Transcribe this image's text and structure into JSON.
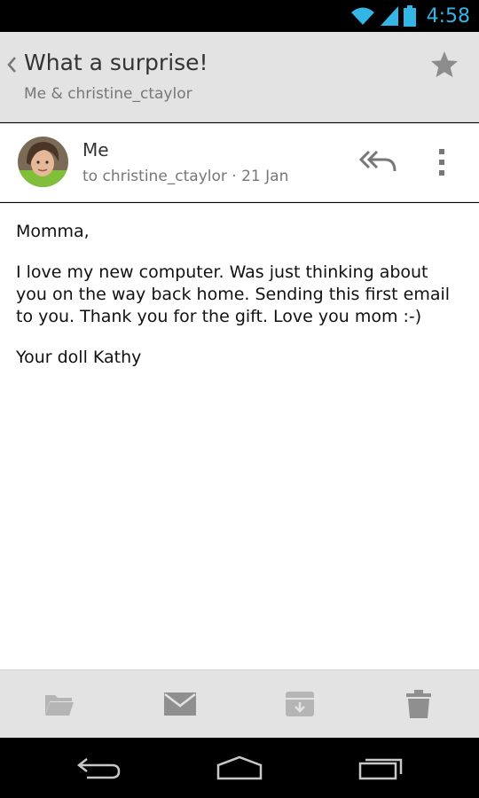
{
  "status_bar": {
    "time": "4:58",
    "icons": [
      "wifi-icon",
      "signal-icon",
      "battery-icon"
    ]
  },
  "header": {
    "subject": "What a surprise!",
    "participants": "Me & christine_ctaylor",
    "back_icon": "chevron-left-icon",
    "star_icon": "star-icon"
  },
  "message": {
    "sender": "Me",
    "recipient_line": "to christine_ctaylor · 21 Jan",
    "actions": [
      "reply-all-icon",
      "overflow-menu-icon"
    ],
    "body": {
      "greeting": "Momma,",
      "paragraph": "I love my new computer. Was just thinking about you on the way back home. Sending this first email to you. Thank you for the gift. Love you mom  :-)",
      "signature": "Your doll Kathy"
    }
  },
  "action_bar": {
    "icons": [
      "folder-icon",
      "mail-icon",
      "archive-icon",
      "trash-icon"
    ]
  },
  "nav_bar": {
    "icons": [
      "back-icon",
      "home-icon",
      "recents-icon"
    ]
  },
  "colors": {
    "accent": "#33b5e5",
    "header_bg": "#e3e3e3",
    "icon_gray": "#777777"
  }
}
